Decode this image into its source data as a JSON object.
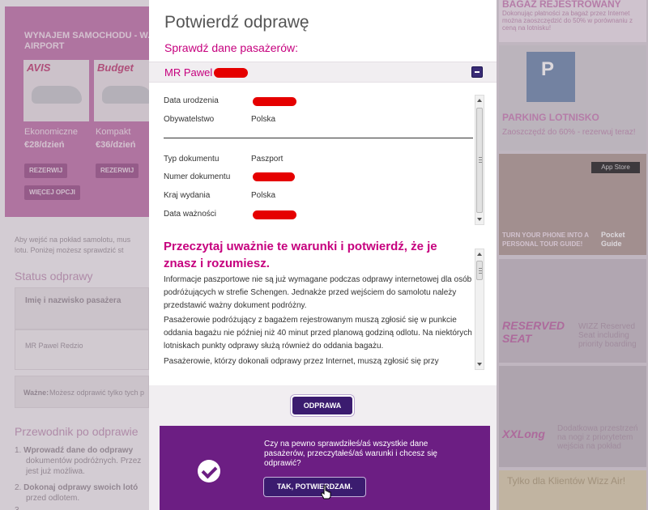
{
  "background": {
    "car_rental": {
      "title": "WYNAJEM SAMOCHODU - W... AIRPORT",
      "cars": [
        {
          "brand": "AVIS",
          "name": "Ekonomiczne",
          "price": "€28/dzień",
          "button": "REZERWIJ"
        },
        {
          "brand": "Budget",
          "name": "Kompakt",
          "price": "€36/dzień",
          "button": "REZERWIJ"
        }
      ],
      "more_button": "WIĘCEJ OPCJI"
    },
    "intro_text_1": "Aby wejść na pokład samolotu, mus",
    "intro_text_2": "lotu. Poniżej możesz sprawdzić st",
    "status_heading": "Status odprawy",
    "table_header": "Imię i nazwisko pasażera",
    "table_row": "MR Pawel Redzio",
    "note_label": "Ważne:",
    "note_text": "Możesz odprawić tylko tych p",
    "guide_heading": "Przewodnik po odprawie",
    "guide_items": [
      {
        "num": "1.",
        "bold": "Wprowadź dane do odprawy",
        "rest": "dokumentów podróżnych. Przez jest już możliwa."
      },
      {
        "num": "2.",
        "bold": "Dokonaj odprawy swoich lotó",
        "rest": "przed odlotem."
      },
      {
        "num": "3.",
        "bold": "",
        "rest": ""
      }
    ],
    "right_col": {
      "ad1_title": "BAGAŻ REJESTROWANY",
      "ad1_text": "Dokonując płatności za bagaż przez Internet można zaoszczędzić do 50% w porównaniu z ceną na lotnisku!",
      "ad2_title": "PARKING LOTNISKO",
      "ad2_text": "Zaoszczędź do 60% - rezerwuj teraz!",
      "ad3_text": "TURN YOUR PHONE INTO A PERSONAL TOUR GUIDE!",
      "ad3_badge": "App Store",
      "ad3_logo": "Pocket Guide",
      "ad4_title": "RESERVED SEAT",
      "ad4_text": "WIZZ Reserved Seat including priority boarding",
      "ad5_title": "XXLong",
      "ad5_text": "Dodatkowa przestrzeń na nogi z priorytetem wejścia na pokład",
      "ad6_text": "Tylko dla Klientów Wizz Air!"
    }
  },
  "modal": {
    "title": "Potwierdź odprawę",
    "subtitle": "Sprawdź dane pasażerów:",
    "passenger_name": "MR Pawel",
    "details": [
      {
        "label": "Data urodzenia",
        "value": ""
      },
      {
        "label": "Obywatelstwo",
        "value": "Polska"
      },
      {
        "label": "Typ dokumentu",
        "value": "Paszport"
      },
      {
        "label": "Numer dokumentu",
        "value": ""
      },
      {
        "label": "Kraj wydania",
        "value": "Polska"
      },
      {
        "label": "Data ważności",
        "value": ""
      }
    ],
    "terms_heading": "Przeczytaj uważnie te warunki i potwierdź, że je znasz i rozumiesz.",
    "terms_paragraphs": [
      "Informacje paszportowe nie są już wymagane podczas odprawy internetowej dla osób podróżujących w strefie Schengen. Jednakże przed wejściem do samolotu należy przedstawić ważny dokument podróżny.",
      "Pasażerowie podróżujący z bagażem rejestrowanym muszą zgłosić się w punkcie oddania bagażu nie później niż 40 minut przed planową godziną odlotu. Na niektórych lotniskach punkty odprawy służą również do oddania bagażu.",
      "Pasażerowie, którzy dokonali odprawy przez Internet, muszą zgłosić się przy"
    ],
    "odprawa_button": "ODPRAWA",
    "confirm_question": "Czy na pewno sprawdziłeś/aś wszystkie dane pasażerów, przeczytałeś/aś warunki i chcesz się odprawić?",
    "confirm_button": "TAK, POTWIERDZAM."
  },
  "colors": {
    "accent_magenta": "#c6007e",
    "button_purple": "#3b1c6f",
    "confirm_panel": "#6c1e83"
  }
}
